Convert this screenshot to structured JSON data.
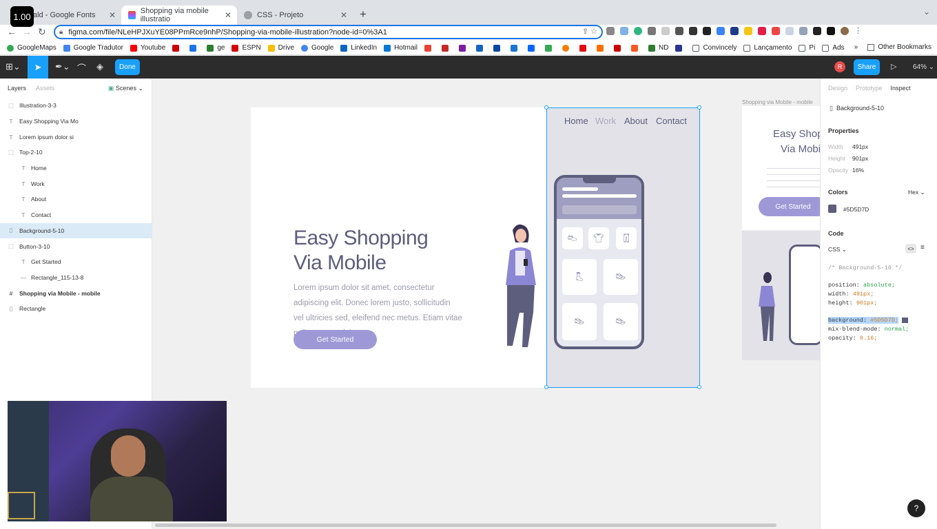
{
  "browser": {
    "zoom_badge": "1.00",
    "tabs": [
      {
        "title": "ald - Google Fonts"
      },
      {
        "title": "Shopping via mobile illustratio"
      },
      {
        "title": "CSS - Projeto"
      }
    ],
    "url": "figma.com/file/NLeHPJXuYE08PPmRce9nhP/Shopping-via-mobile-illustration?node-id=0%3A1",
    "bookmarks": [
      "GoogleMaps",
      "Google Tradutor",
      "Youtube",
      "",
      "",
      "ge",
      "ESPN",
      "Drive",
      "Google",
      "LinkedIn",
      "Hotmail",
      "",
      "",
      "",
      "",
      "",
      "",
      "",
      "",
      "",
      "",
      "",
      "",
      "ND",
      "",
      "Convincely",
      "Lançamento",
      "Pi",
      "Ads"
    ],
    "other_bookmarks": "Other Bookmarks"
  },
  "figma": {
    "done_label": "Done",
    "avatar_letter": "R",
    "share_label": "Share",
    "zoom": "64%",
    "left_tabs": {
      "layers": "Layers",
      "assets": "Assets",
      "scenes": "Scenes"
    },
    "layers": [
      {
        "name": "Illustration-3-3",
        "icon": "frame-icon",
        "indent": 0
      },
      {
        "name": "Easy Shopping Via Mo",
        "icon": "text-icon",
        "indent": 0
      },
      {
        "name": "Lorem ipsum dolor si",
        "icon": "text-icon",
        "indent": 0
      },
      {
        "name": "Top-2-10",
        "icon": "frame-icon",
        "indent": 0
      },
      {
        "name": "Home",
        "icon": "text-icon",
        "indent": 1
      },
      {
        "name": "Work",
        "icon": "text-icon",
        "indent": 1
      },
      {
        "name": "About",
        "icon": "text-icon",
        "indent": 1
      },
      {
        "name": "Contact",
        "icon": "text-icon",
        "indent": 1
      },
      {
        "name": "Background-5-10",
        "icon": "rect-icon",
        "indent": 0,
        "selected": true
      },
      {
        "name": "Button-3-10",
        "icon": "frame-icon",
        "indent": 0
      },
      {
        "name": "Get Started",
        "icon": "text-icon",
        "indent": 1
      },
      {
        "name": "Rectangle_115-13-8",
        "icon": "line-icon",
        "indent": 1
      },
      {
        "name": "Shopping via Mobile - mobile",
        "icon": "hash-icon",
        "indent": 0,
        "bold": true
      },
      {
        "name": "Rectangle",
        "icon": "rect-icon",
        "indent": 0
      }
    ],
    "canvas": {
      "hero_title_1": "Easy Shopping",
      "hero_title_2": "Via Mobile",
      "hero_text": "Lorem ipsum dolor sit amet, consectetur  adipiscing elit. Donec lorem justo, sollicitudin vel ultricies sed, eleifend nec metus. Etiam vitae pellentesque dolor.",
      "cta": "Get Started",
      "nav": [
        "Home",
        "Work",
        "About",
        "Contact"
      ],
      "mobile_frame_label": "Shopping via Mobile - mobile",
      "mobile_title_1": "Easy Shopp",
      "mobile_title_2": "Via Mobil",
      "mobile_cta": "Get Started"
    },
    "right_tabs": {
      "design": "Design",
      "prototype": "Prototype",
      "inspect": "Inspect"
    },
    "selection": "Background-5-10",
    "properties_title": "Properties",
    "properties": [
      {
        "label": "Width",
        "value": "491px"
      },
      {
        "label": "Height",
        "value": "901px"
      },
      {
        "label": "Opacity",
        "value": "16%"
      }
    ],
    "colors_title": "Colors",
    "colors_format": "Hex",
    "color_hex": "#5D5D7D",
    "code_title": "Code",
    "code_lang": "CSS",
    "code": {
      "comment": "/* Background-5-10 */",
      "position_k": "position:",
      "position_v": "absolute;",
      "width_k": "width:",
      "width_v": "491px;",
      "height_k": "height:",
      "height_v": "901px;",
      "bg_k": "background:",
      "bg_v": "#5D5D7D;",
      "blend_k": "mix-blend-mode:",
      "blend_v": "normal;",
      "opacity_k": "opacity:",
      "opacity_v": "0.16;"
    },
    "help": "?"
  },
  "colors": {
    "accent": "#18a0fb",
    "brand_text": "#5d5d7d",
    "cta": "#9e99d6"
  }
}
